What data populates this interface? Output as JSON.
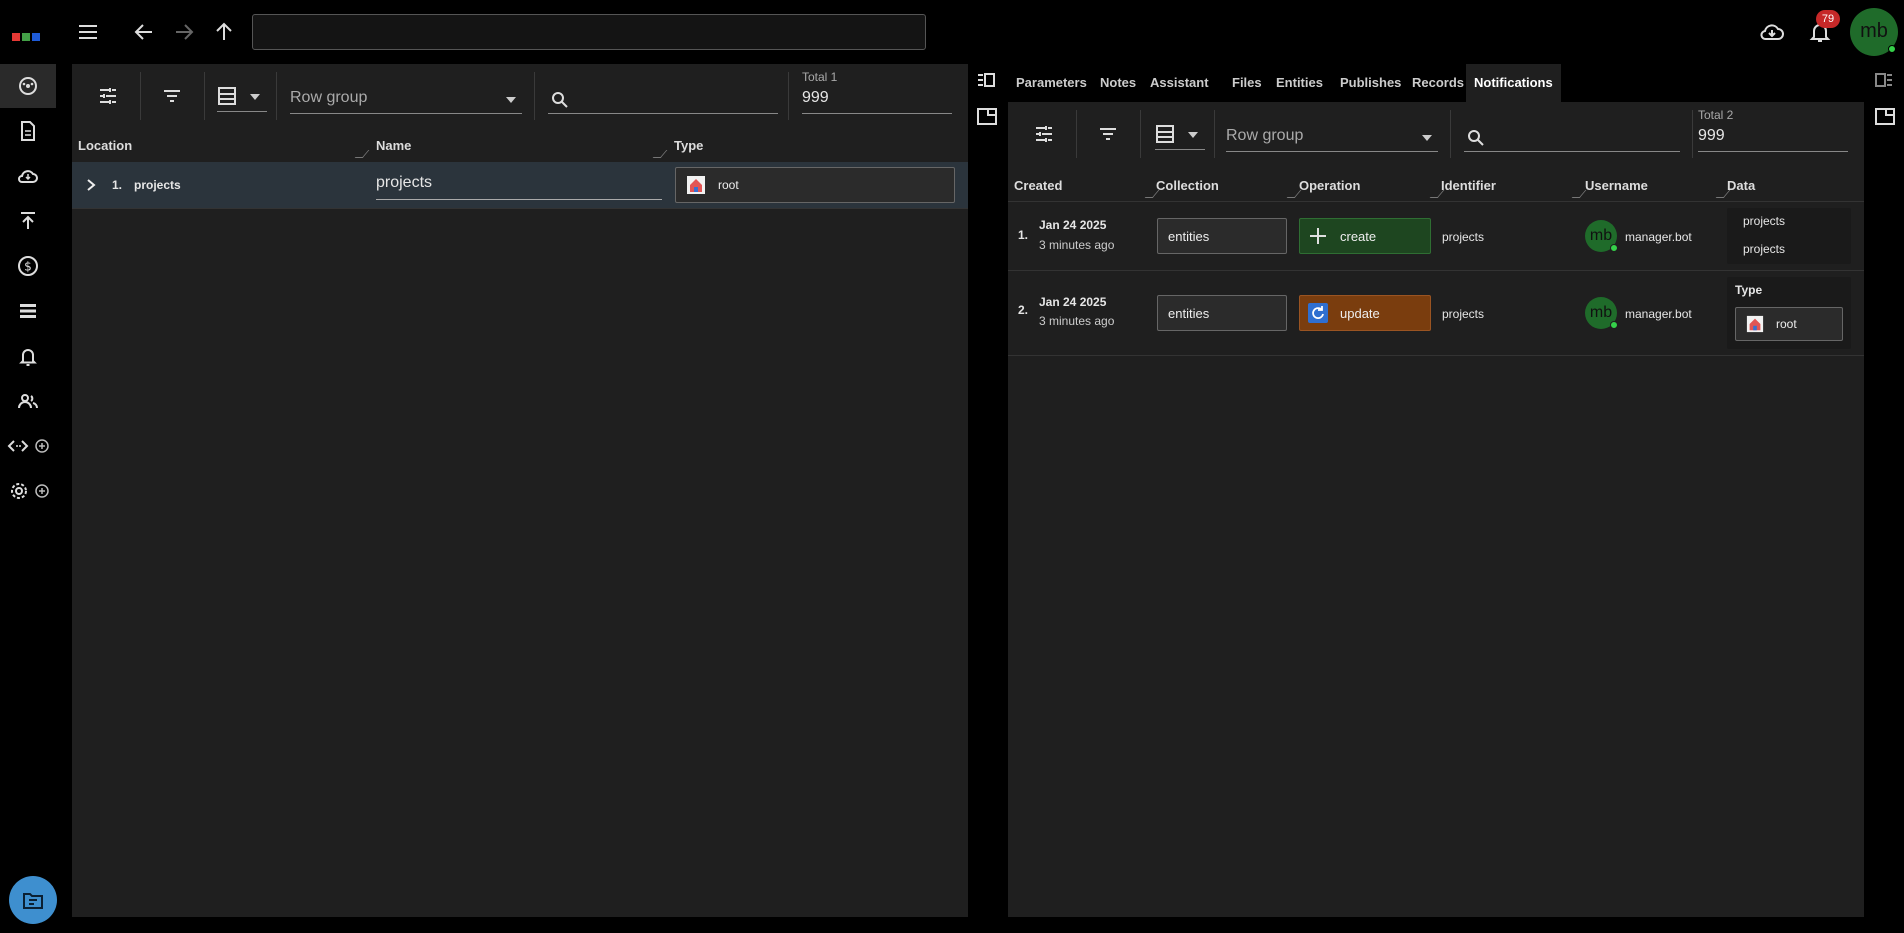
{
  "app": {
    "notification_count": "79",
    "user_initials": "mb"
  },
  "left_panel": {
    "row_group": {
      "label": "Row group"
    },
    "total": {
      "label": "Total 1",
      "value": "999"
    },
    "columns": [
      "Location",
      "Name",
      "Type"
    ],
    "rows": [
      {
        "index": "1.",
        "location": "projects",
        "name": "projects",
        "type": "root"
      }
    ]
  },
  "right_panel": {
    "tabs": [
      "Parameters",
      "Notes",
      "Assistant",
      "Files",
      "Entities",
      "Publishes",
      "Records",
      "Notifications"
    ],
    "active_tab": "Notifications",
    "row_group": {
      "label": "Row group"
    },
    "total": {
      "label": "Total 2",
      "value": "999"
    },
    "columns": [
      "Created",
      "Collection",
      "Operation",
      "Identifier",
      "Username",
      "Data"
    ],
    "rows": [
      {
        "index": "1.",
        "created_date": "Jan 24 2025",
        "created_ago": "3 minutes ago",
        "collection": "entities",
        "operation": "create",
        "identifier": "projects",
        "avatar": "mb",
        "username": "manager.bot",
        "data_lines": [
          "projects",
          "projects"
        ]
      },
      {
        "index": "2.",
        "created_date": "Jan 24 2025",
        "created_ago": "3 minutes ago",
        "collection": "entities",
        "operation": "update",
        "identifier": "projects",
        "avatar": "mb",
        "username": "manager.bot",
        "data_label": "Type",
        "data_value": "root"
      }
    ]
  },
  "colors": {
    "create": "#1e4620",
    "update": "#7a3d0e",
    "accent": "#3e8fcf",
    "badge": "#c62828",
    "avatar": "#1f6b2a"
  }
}
